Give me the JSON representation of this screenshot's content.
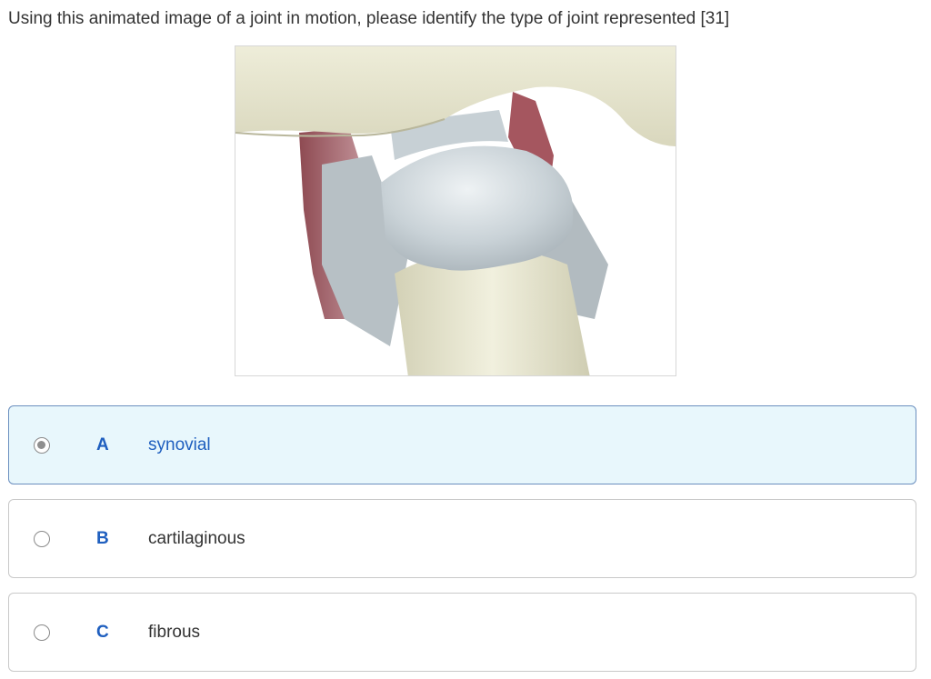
{
  "question": {
    "text": "Using this animated image of a joint in motion, please identify the type of joint represented [31]"
  },
  "figure": {
    "icon": "shoulder-joint-model-image"
  },
  "options": [
    {
      "letter": "A",
      "text": "synovial",
      "selected": true
    },
    {
      "letter": "B",
      "text": "cartilaginous",
      "selected": false
    },
    {
      "letter": "C",
      "text": "fibrous",
      "selected": false
    }
  ],
  "colors": {
    "accent": "#1f5fbf",
    "selected_background": "#e8f7fc",
    "selected_border": "#6b8fbf"
  }
}
